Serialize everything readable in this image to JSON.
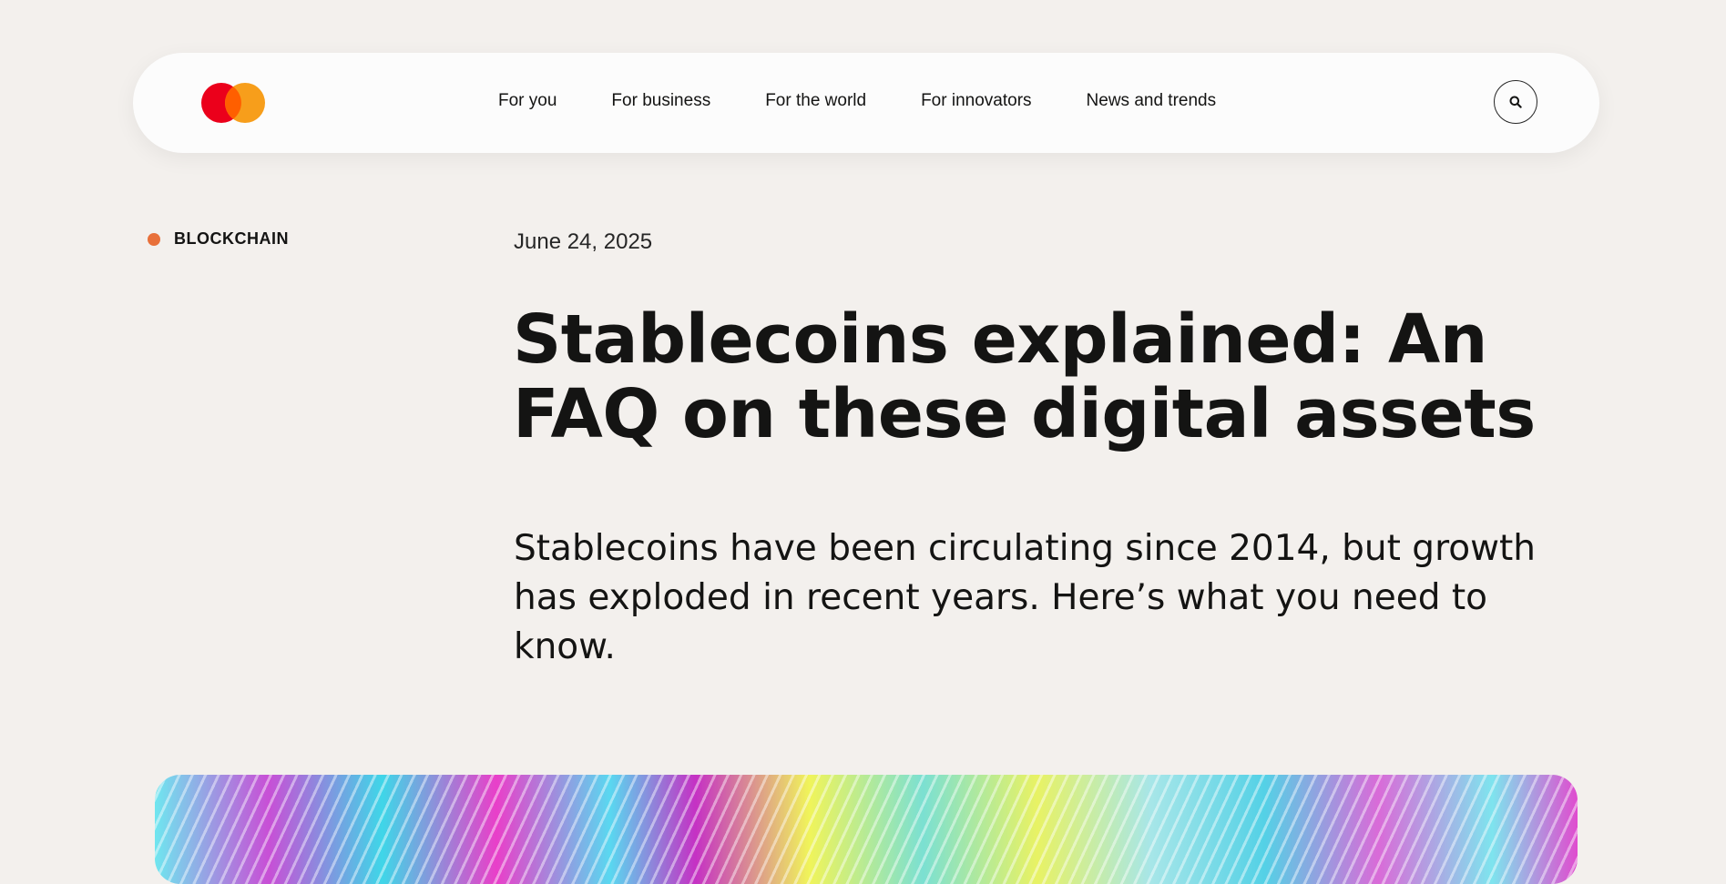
{
  "header": {
    "logo_alt": "Mastercard",
    "brand_colors": {
      "red": "#eb001b",
      "orange": "#f79e1b",
      "overlap": "#ff5f00"
    },
    "nav": [
      {
        "label": "For you"
      },
      {
        "label": "For business"
      },
      {
        "label": "For the world"
      },
      {
        "label": "For innovators"
      },
      {
        "label": "News and trends"
      }
    ],
    "search_icon": "search-icon"
  },
  "article": {
    "category": "BLOCKCHAIN",
    "category_color": "#e8703a",
    "date": "June 24, 2025",
    "title": "Stablecoins explained: An FAQ on these digital assets",
    "subtitle": "Stablecoins have been circulating since 2014, but growth has exploded in recent years. Here’s what you need to know."
  }
}
